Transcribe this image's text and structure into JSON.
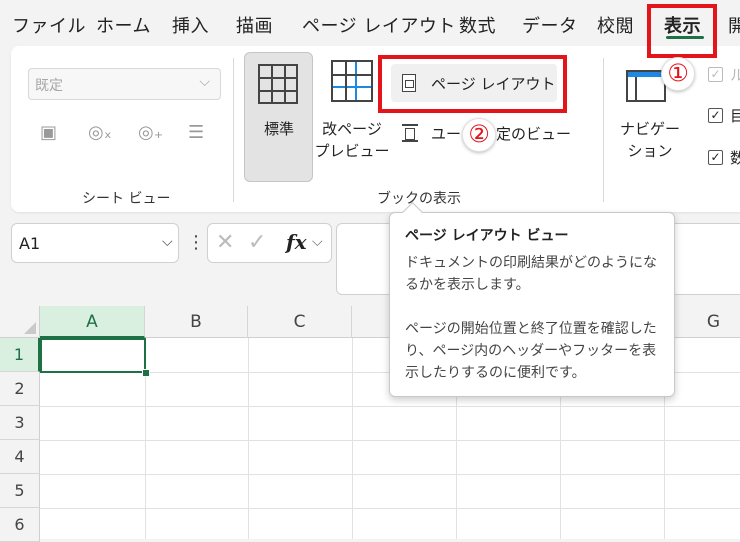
{
  "menu": {
    "items": [
      "ファイル",
      "ホーム",
      "挿入",
      "描画",
      "ページ レイアウト",
      "数式",
      "データ",
      "校閲",
      "表示",
      "開"
    ],
    "active": "表示"
  },
  "ribbon": {
    "sheet_view": {
      "dropdown_value": "既定",
      "group_label": "シート ビュー"
    },
    "workbook_views": {
      "normal_label": "標準",
      "page_break_label": "改ページ\nプレビュー",
      "page_layout_label": "ページ レイアウト",
      "custom_views_prefix": "ユー",
      "custom_views_suffix": "定のビュー",
      "group_label": "ブックの表示"
    },
    "navigation_label": "ナビゲー\nション",
    "checkbox_labels": [
      "ル",
      "目",
      "数"
    ]
  },
  "annotations": {
    "step1": "①",
    "step2": "②"
  },
  "formula_bar": {
    "name_box": "A1",
    "fx": "fx"
  },
  "sheet": {
    "columns": [
      "A",
      "B",
      "C",
      "G"
    ],
    "rows": [
      "1",
      "2",
      "3",
      "4",
      "5",
      "6"
    ]
  },
  "tooltip": {
    "title": "ページ レイアウト ビュー",
    "para1": "ドキュメントの印刷結果がどのようになるかを表示します。",
    "para2": "ページの開始位置と終了位置を確認したり、ページ内のヘッダーやフッターを表示したりするのに便利です。"
  },
  "colors": {
    "accent_green": "#1e7145",
    "highlight_red": "#e4141b"
  }
}
